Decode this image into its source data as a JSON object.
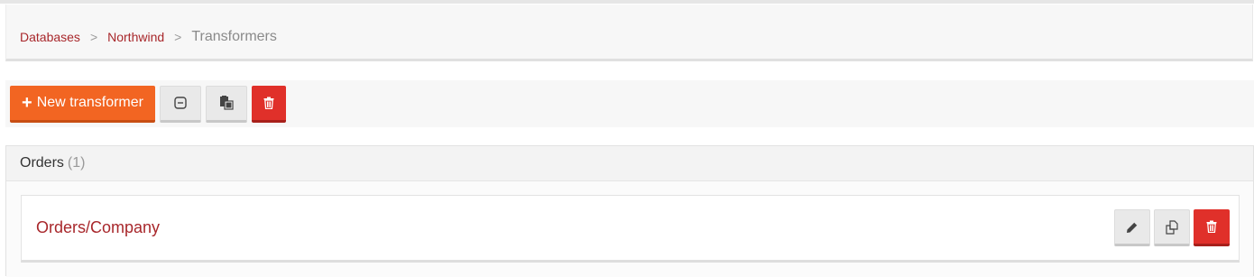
{
  "breadcrumb": {
    "items": [
      {
        "label": "Databases"
      },
      {
        "label": "Northwind"
      }
    ],
    "separator": ">",
    "current": "Transformers"
  },
  "toolbar": {
    "new_label": "New transformer",
    "plus_glyph": "+",
    "collapse_icon": "collapse-icon",
    "copy_icon": "paste-icon",
    "delete_icon": "trash-icon"
  },
  "group": {
    "title": "Orders",
    "count": "(1)",
    "items": [
      {
        "name": "Orders/Company",
        "actions": [
          "pencil-icon",
          "copy-icon",
          "trash-icon"
        ]
      }
    ]
  },
  "colors": {
    "accent": "#f26522",
    "danger": "#e0302a",
    "link": "#a8272b"
  }
}
